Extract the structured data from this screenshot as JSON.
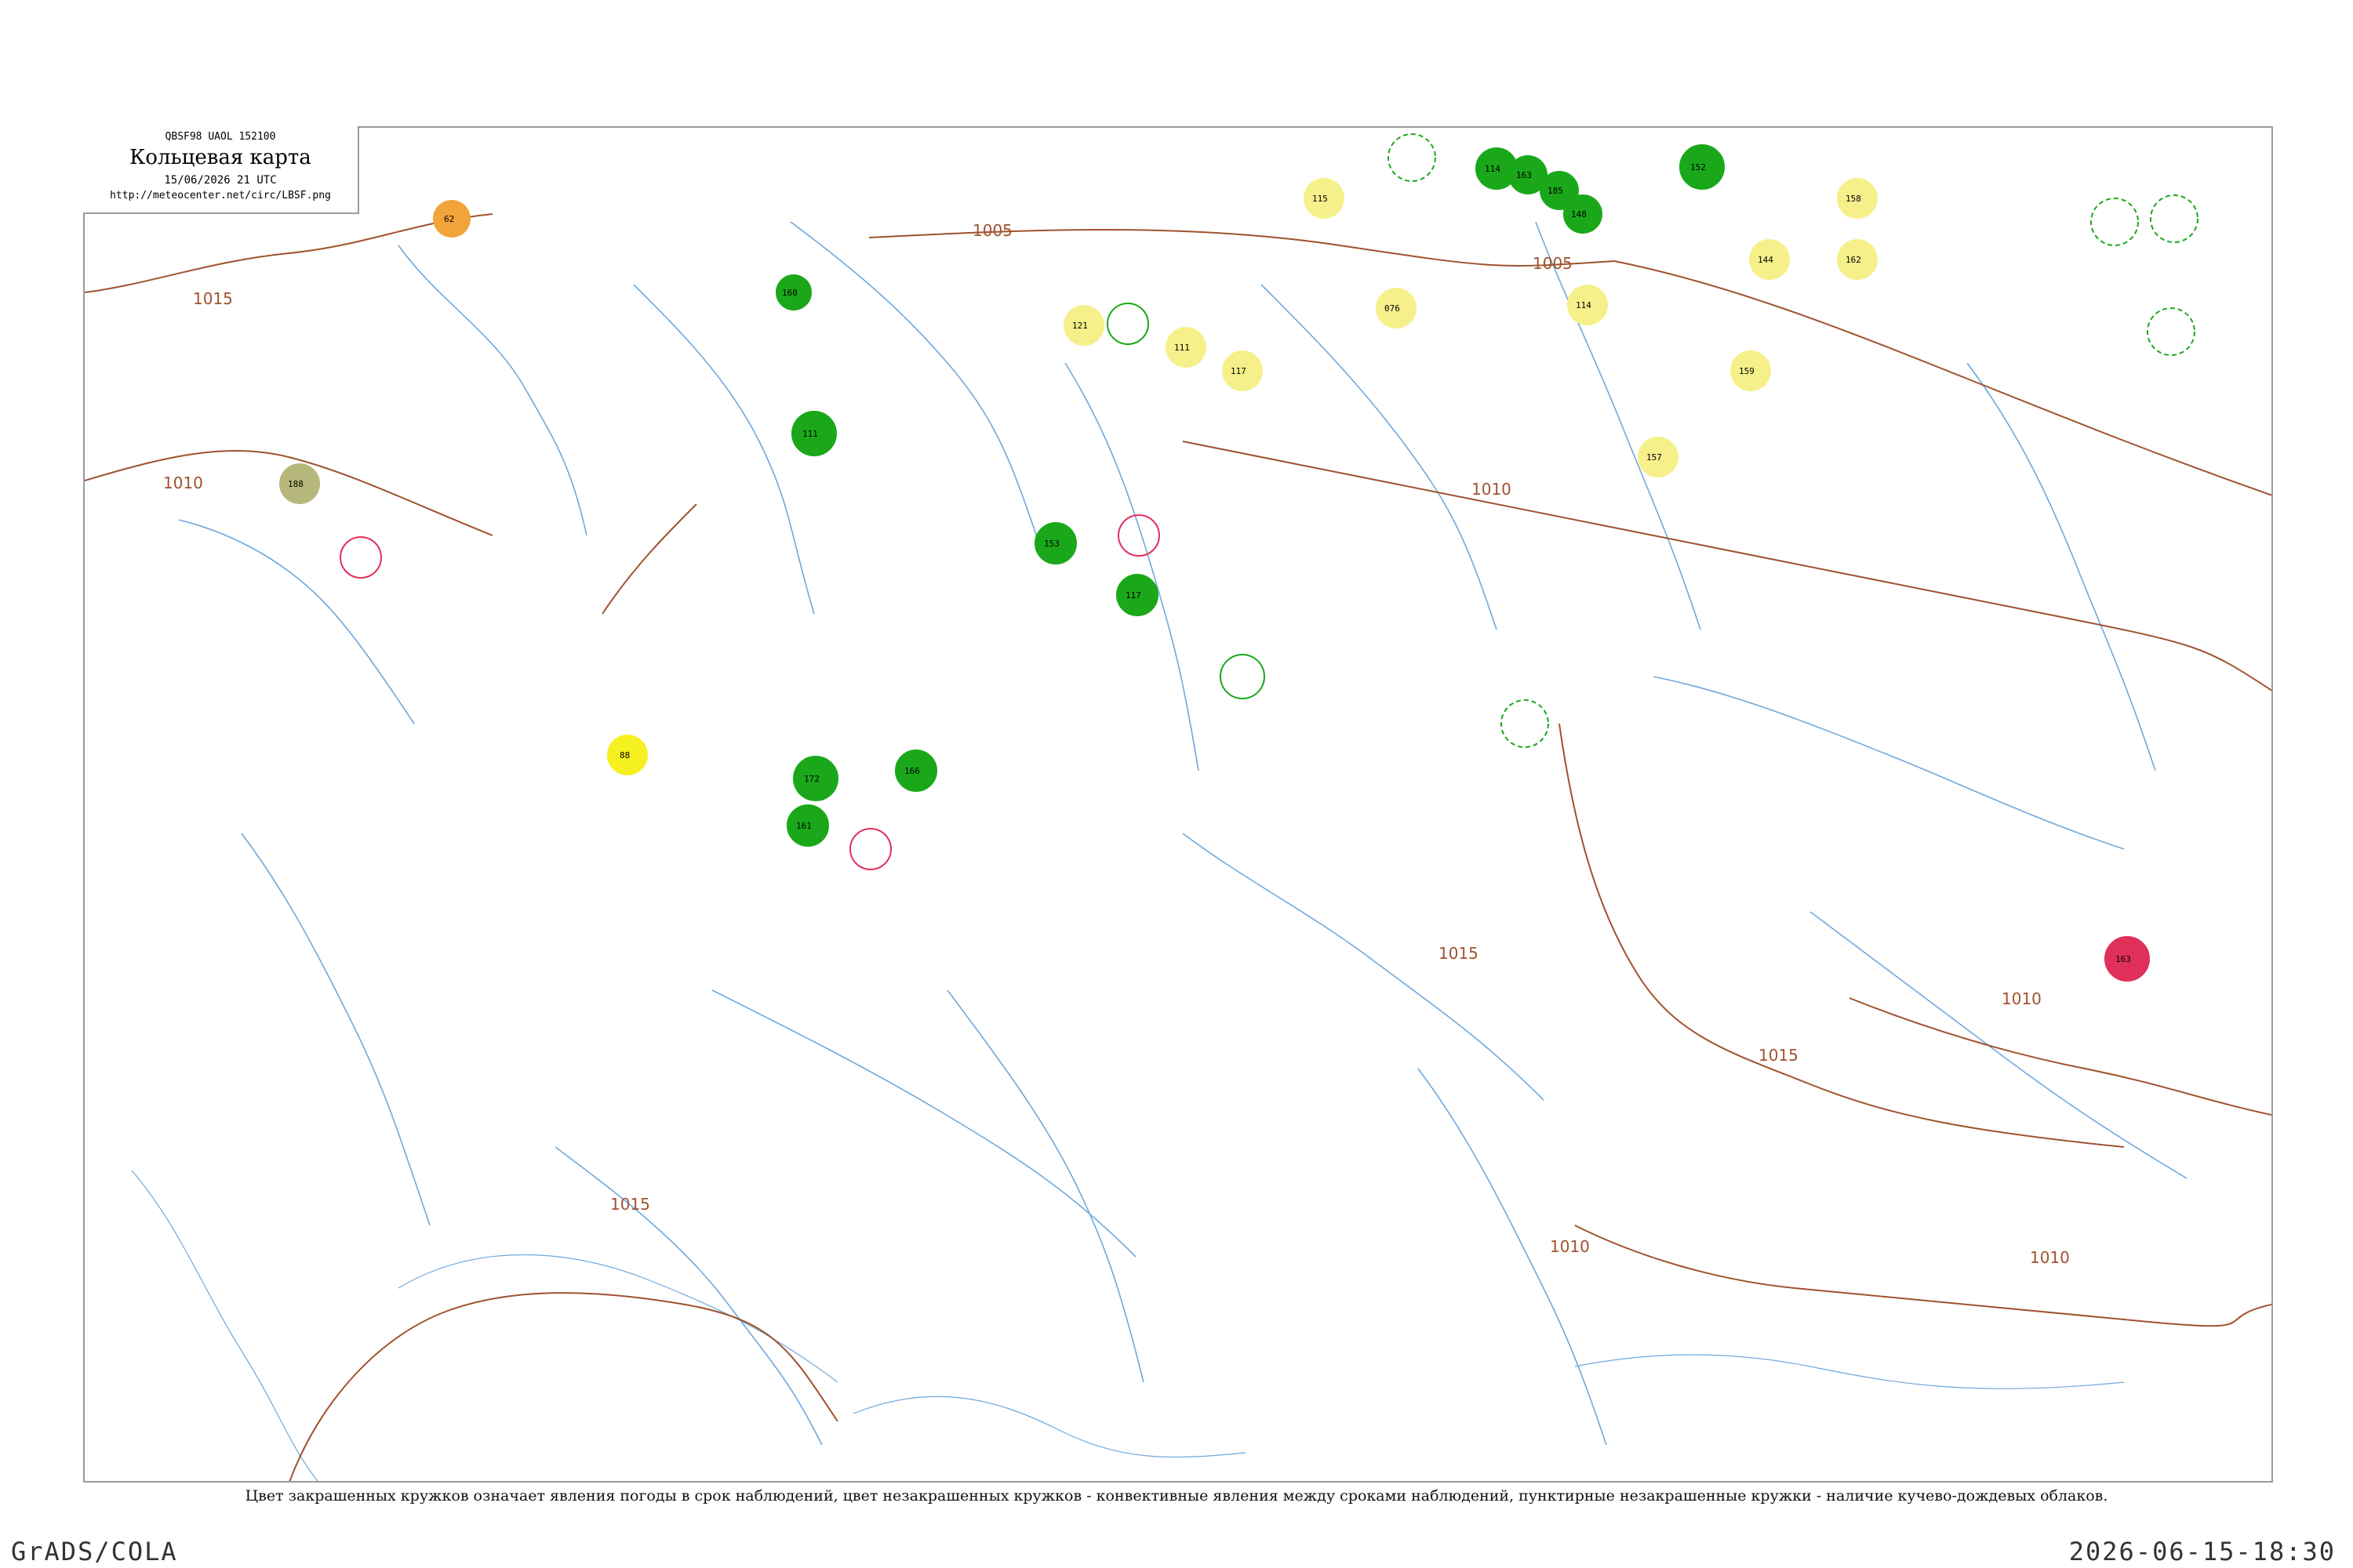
{
  "header": {
    "code": "QBSF98  UAOL  152100",
    "title": "Кольцевая карта",
    "datetime": "15/06/2026 21 UTC",
    "url": "http://meteocenter.net/circ/LBSF.png"
  },
  "caption": "Цвет закрашенных кружков означает явления погоды в срок наблюдений, цвет незакрашенных кружков - конвективные явления между сроками наблюдений, пунктирные незакрашенные кружки - наличие кучево-дождевых облаков.",
  "footer": {
    "left": "GrADS/COLA",
    "right": "2026-06-15-18:30"
  },
  "isobars": [
    "1015",
    "1010",
    "1005",
    "1010",
    "1005",
    "1015",
    "1010",
    "1015",
    "1010",
    "1015",
    "1010"
  ],
  "colors": {
    "isobar": "#a0522d",
    "rivers": "#6fa8dc",
    "green": "#1aa81a",
    "yellow": "#f5f08a",
    "orange": "#f2a33a",
    "olive": "#b5b87a",
    "red": "#e0305a",
    "bright_yellow": "#f5f020"
  },
  "stations": [
    {
      "label": "160",
      "color": "#1aa81a"
    },
    {
      "label": "111",
      "color": "#1aa81a"
    },
    {
      "label": "153",
      "color": "#1aa81a"
    },
    {
      "label": "117",
      "color": "#1aa81a"
    },
    {
      "label": "114",
      "color": "#1aa81a"
    },
    {
      "label": "163",
      "color": "#1aa81a"
    },
    {
      "label": "185",
      "color": "#1aa81a"
    },
    {
      "label": "148",
      "color": "#1aa81a"
    },
    {
      "label": "152",
      "color": "#1aa81a"
    },
    {
      "label": "172",
      "color": "#1aa81a"
    },
    {
      "label": "166",
      "color": "#1aa81a"
    },
    {
      "label": "161",
      "color": "#1aa81a"
    },
    {
      "label": "121",
      "color": "#f5f08a"
    },
    {
      "label": "111",
      "color": "#f5f08a"
    },
    {
      "label": "117",
      "color": "#f5f08a"
    },
    {
      "label": "076",
      "color": "#f5f08a"
    },
    {
      "label": "114",
      "color": "#f5f08a"
    },
    {
      "label": "157",
      "color": "#f5f08a"
    },
    {
      "label": "159",
      "color": "#f5f08a"
    },
    {
      "label": "158",
      "color": "#f5f08a"
    },
    {
      "label": "162",
      "color": "#f5f08a"
    },
    {
      "label": "144",
      "color": "#f5f08a"
    },
    {
      "label": "115",
      "color": "#f5f08a"
    },
    {
      "label": "62",
      "color": "#f2a33a"
    },
    {
      "label": "188",
      "color": "#b5b87a"
    },
    {
      "label": "163",
      "color": "#e0305a"
    },
    {
      "label": "88",
      "color": "#f5f020"
    }
  ]
}
